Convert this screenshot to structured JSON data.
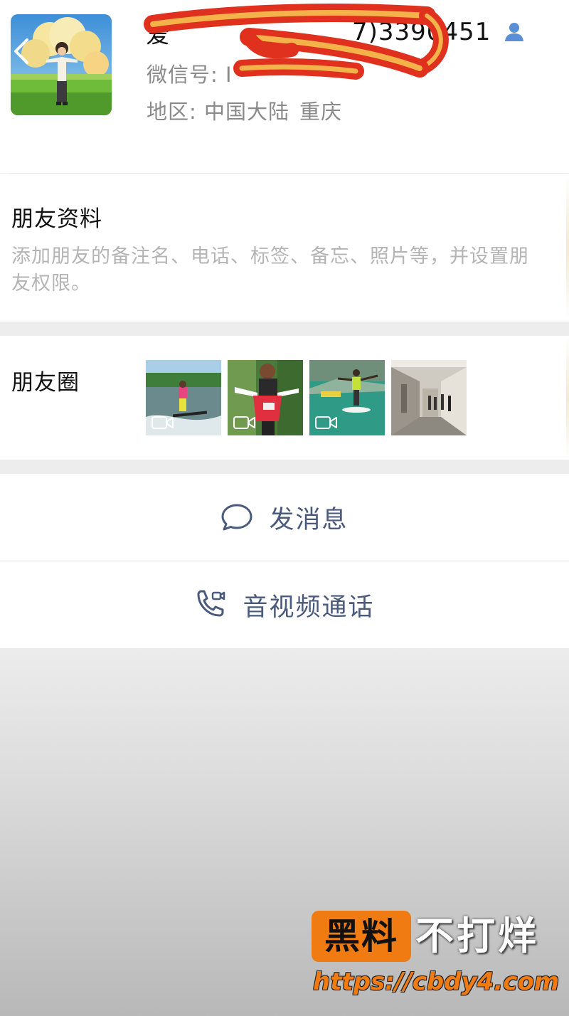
{
  "profile": {
    "name_visible": "爱",
    "name_suffix": "7)3390451",
    "wechat_id_label": "微信号:",
    "wechat_id_visible": "I",
    "region_label": "地区:",
    "region_value_1": "中国大陆",
    "region_value_2": "重庆"
  },
  "friend_info": {
    "title": "朋友资料",
    "description_line1": "添加朋友的备注名、电话、标签、备忘、照片等，并设置朋",
    "description_line2": "友权限。"
  },
  "moments": {
    "title": "朋友圈",
    "thumbnails": [
      {
        "subject": "water-ski video",
        "is_video": true
      },
      {
        "subject": "motorbike video",
        "is_video": true
      },
      {
        "subject": "hoverboard on water video",
        "is_video": true
      },
      {
        "subject": "hallway photo",
        "is_video": false
      }
    ]
  },
  "actions": {
    "send_message": "发消息",
    "voice_video_call": "音视频通话"
  },
  "watermark": {
    "badge": "黑料",
    "tail": "不打烊",
    "url": "https://cbdy4.com"
  },
  "colors": {
    "action_text": "#4a5a7c",
    "contact_icon": "#5a8fd6",
    "watermark_orange": "#f07b12",
    "scribble_red": "#e0301e",
    "scribble_yellow": "#f4b24a"
  }
}
